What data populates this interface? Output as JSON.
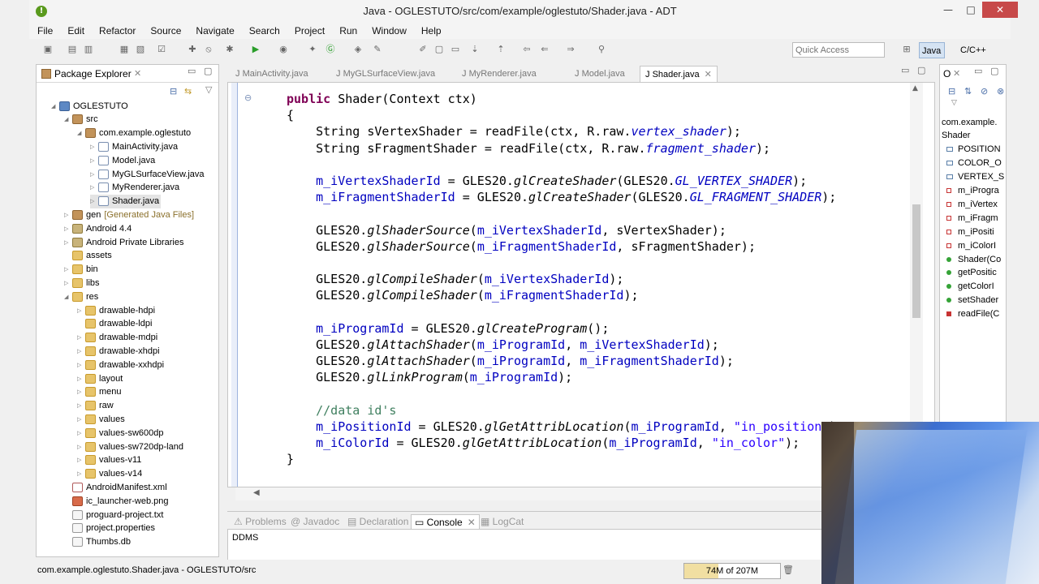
{
  "window": {
    "title": "Java - OGLESTUTO/src/com/example/oglestuto/Shader.java - ADT",
    "app_icon": "!",
    "minimize": "—",
    "maximize": "□",
    "close": "✕"
  },
  "menu": [
    "File",
    "Edit",
    "Refactor",
    "Source",
    "Navigate",
    "Search",
    "Project",
    "Run",
    "Window",
    "Help"
  ],
  "toolbar": {
    "quick_access_placeholder": "Quick Access",
    "perspective_java": "Java",
    "perspective_cpp": "C/C++"
  },
  "package_explorer": {
    "title": "Package Explorer",
    "tree": [
      {
        "label": "OGLESTUTO",
        "icon": "project",
        "twisty": "◢",
        "indent": 0
      },
      {
        "label": "src",
        "icon": "package",
        "twisty": "◢",
        "indent": 1
      },
      {
        "label": "com.example.oglestuto",
        "icon": "package",
        "twisty": "◢",
        "indent": 2
      },
      {
        "label": "MainActivity.java",
        "icon": "java",
        "twisty": "▷",
        "indent": 3
      },
      {
        "label": "Model.java",
        "icon": "java",
        "twisty": "▷",
        "indent": 3
      },
      {
        "label": "MyGLSurfaceView.java",
        "icon": "java",
        "twisty": "▷",
        "indent": 3
      },
      {
        "label": "MyRenderer.java",
        "icon": "java",
        "twisty": "▷",
        "indent": 3
      },
      {
        "label": "Shader.java",
        "icon": "java",
        "twisty": "▷",
        "indent": 3,
        "selected": true
      },
      {
        "label": "gen",
        "suffix": "[Generated Java Files]",
        "icon": "package",
        "twisty": "▷",
        "indent": 1
      },
      {
        "label": "Android 4.4",
        "icon": "lib",
        "twisty": "▷",
        "indent": 1
      },
      {
        "label": "Android Private Libraries",
        "icon": "lib",
        "twisty": "▷",
        "indent": 1
      },
      {
        "label": "assets",
        "icon": "folder",
        "twisty": "",
        "indent": 1
      },
      {
        "label": "bin",
        "icon": "folder",
        "twisty": "▷",
        "indent": 1
      },
      {
        "label": "libs",
        "icon": "folder",
        "twisty": "▷",
        "indent": 1
      },
      {
        "label": "res",
        "icon": "folder",
        "twisty": "◢",
        "indent": 1
      },
      {
        "label": "drawable-hdpi",
        "icon": "folder",
        "twisty": "▷",
        "indent": 2
      },
      {
        "label": "drawable-ldpi",
        "icon": "folder",
        "twisty": "",
        "indent": 2
      },
      {
        "label": "drawable-mdpi",
        "icon": "folder",
        "twisty": "▷",
        "indent": 2
      },
      {
        "label": "drawable-xhdpi",
        "icon": "folder",
        "twisty": "▷",
        "indent": 2
      },
      {
        "label": "drawable-xxhdpi",
        "icon": "folder",
        "twisty": "▷",
        "indent": 2
      },
      {
        "label": "layout",
        "icon": "folder",
        "twisty": "▷",
        "indent": 2
      },
      {
        "label": "menu",
        "icon": "folder",
        "twisty": "▷",
        "indent": 2
      },
      {
        "label": "raw",
        "icon": "folder",
        "twisty": "▷",
        "indent": 2
      },
      {
        "label": "values",
        "icon": "folder",
        "twisty": "▷",
        "indent": 2
      },
      {
        "label": "values-sw600dp",
        "icon": "folder",
        "twisty": "▷",
        "indent": 2
      },
      {
        "label": "values-sw720dp-land",
        "icon": "folder",
        "twisty": "▷",
        "indent": 2
      },
      {
        "label": "values-v11",
        "icon": "folder",
        "twisty": "▷",
        "indent": 2
      },
      {
        "label": "values-v14",
        "icon": "folder",
        "twisty": "▷",
        "indent": 2
      },
      {
        "label": "AndroidManifest.xml",
        "icon": "xml",
        "twisty": "",
        "indent": 1
      },
      {
        "label": "ic_launcher-web.png",
        "icon": "img",
        "twisty": "",
        "indent": 1
      },
      {
        "label": "proguard-project.txt",
        "icon": "file",
        "twisty": "",
        "indent": 1
      },
      {
        "label": "project.properties",
        "icon": "file",
        "twisty": "",
        "indent": 1
      },
      {
        "label": "Thumbs.db",
        "icon": "file",
        "twisty": "",
        "indent": 1
      }
    ]
  },
  "editor": {
    "tabs": [
      {
        "label": "MainActivity.java",
        "active": false
      },
      {
        "label": "MyGLSurfaceView.java",
        "active": false
      },
      {
        "label": "MyRenderer.java",
        "active": false
      },
      {
        "label": "Model.java",
        "active": false
      },
      {
        "label": "Shader.java",
        "active": true
      }
    ],
    "fold_marker": "⊖"
  },
  "bottom_panel": {
    "tabs": [
      {
        "label": "Problems",
        "active": false
      },
      {
        "label": "Javadoc",
        "active": false
      },
      {
        "label": "Declaration",
        "active": false
      },
      {
        "label": "Console",
        "active": true
      },
      {
        "label": "LogCat",
        "active": false
      }
    ],
    "console_text": "DDMS"
  },
  "outline": {
    "title": "O",
    "items": [
      {
        "label": "com.example.",
        "kind": "package"
      },
      {
        "label": "Shader",
        "kind": "class"
      },
      {
        "label": "POSITION",
        "kind": "const"
      },
      {
        "label": "COLOR_O",
        "kind": "const"
      },
      {
        "label": "VERTEX_S",
        "kind": "const"
      },
      {
        "label": "m_iProgra",
        "kind": "private-field"
      },
      {
        "label": "m_iVertex",
        "kind": "private-field"
      },
      {
        "label": "m_iFragm",
        "kind": "private-field"
      },
      {
        "label": "m_iPositi",
        "kind": "private-field"
      },
      {
        "label": "m_iColorI",
        "kind": "private-field"
      },
      {
        "label": "Shader(Co",
        "kind": "constructor"
      },
      {
        "label": "getPositic",
        "kind": "public-method"
      },
      {
        "label": "getColorI",
        "kind": "public-method"
      },
      {
        "label": "setShader",
        "kind": "public-method"
      },
      {
        "label": "readFile(C",
        "kind": "private-method"
      }
    ]
  },
  "statusbar": {
    "text": "com.example.oglestuto.Shader.java - OGLESTUTO/src",
    "heap": "74M of 207M",
    "heap_used_fraction": 0.357
  }
}
